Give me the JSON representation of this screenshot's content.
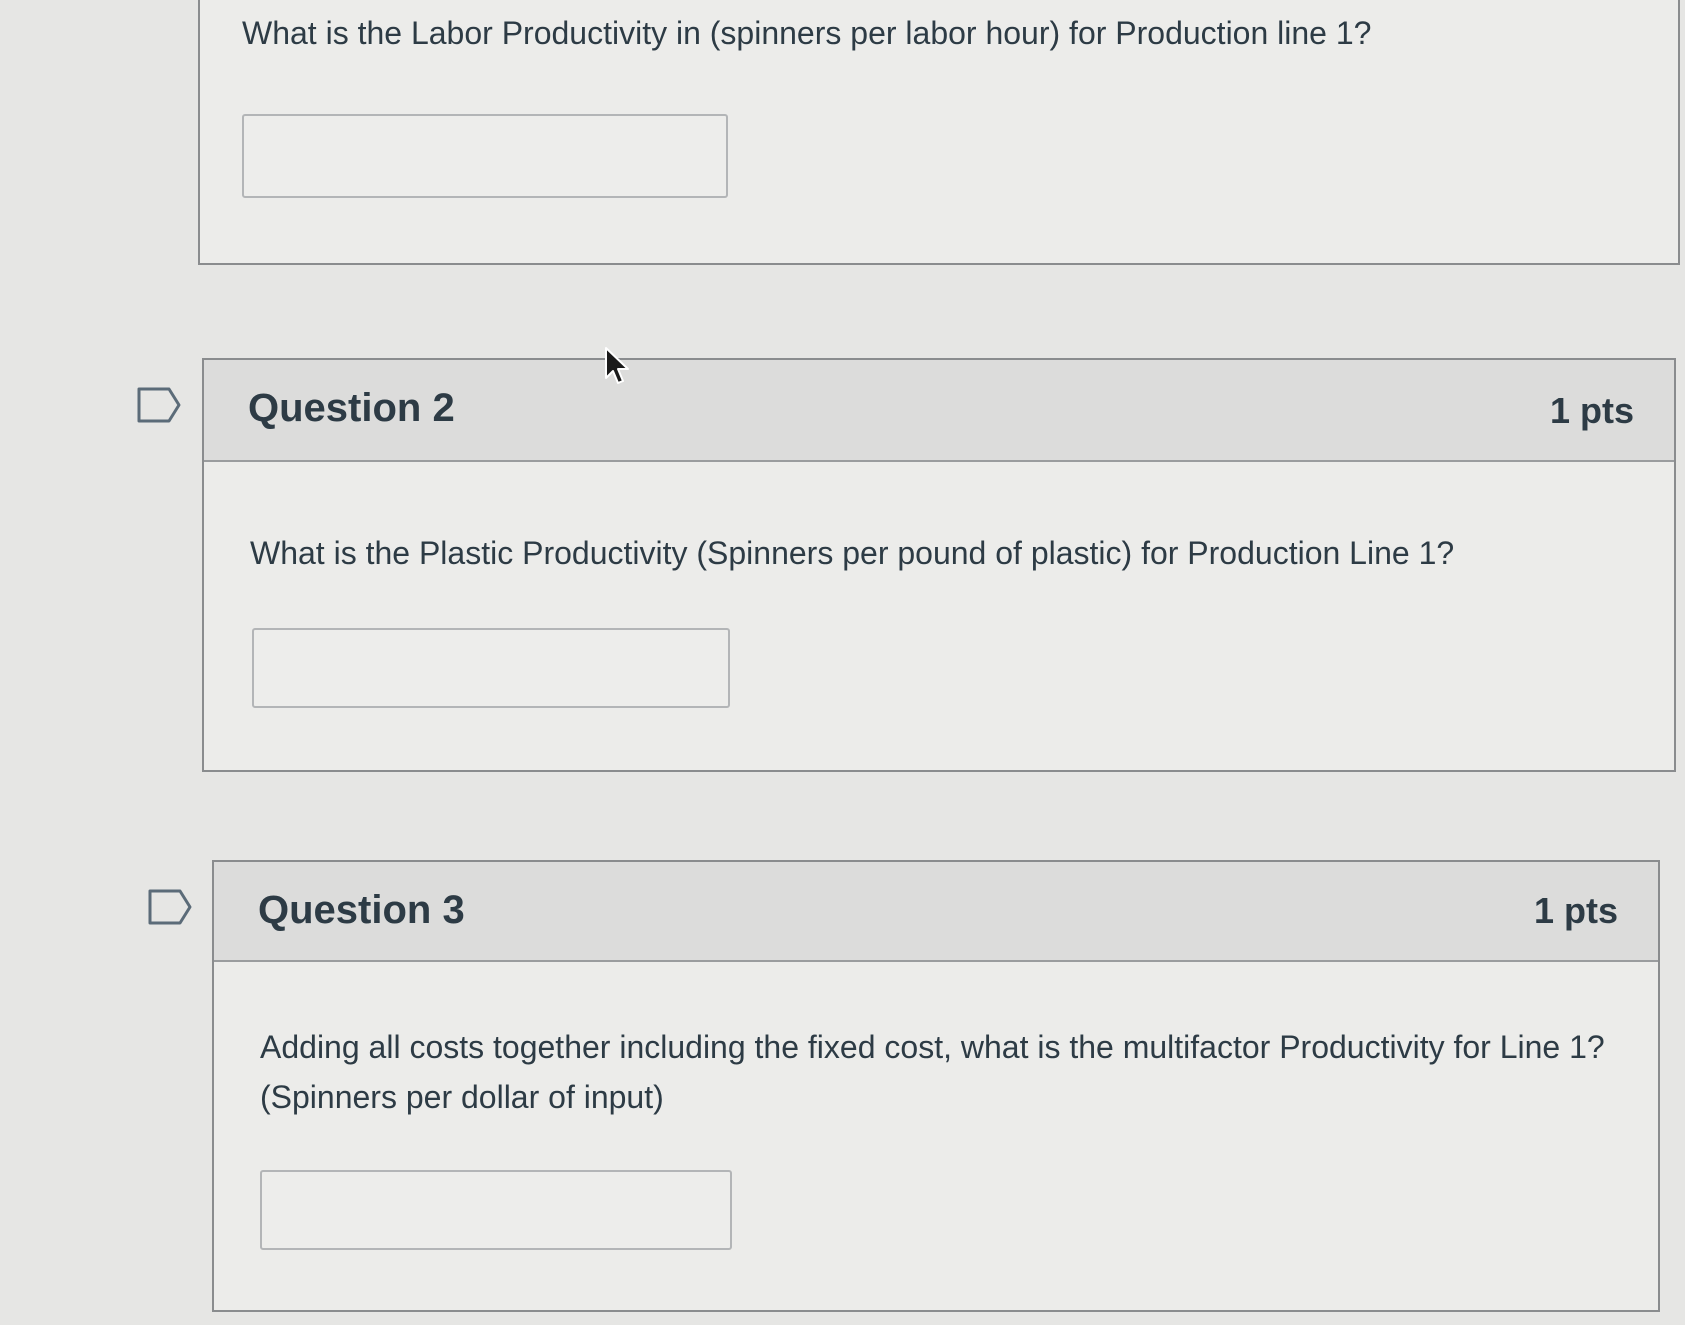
{
  "question1": {
    "text": "What is the Labor Productivity in (spinners per labor hour) for Production line 1?",
    "answer_value": ""
  },
  "question2": {
    "title": "Question 2",
    "points": "1 pts",
    "text": "What is the Plastic Productivity (Spinners per pound of plastic) for Production Line 1?",
    "answer_value": ""
  },
  "question3": {
    "title": "Question 3",
    "points": "1 pts",
    "text": "Adding all costs together including the fixed cost, what is the multifactor Productivity for Line 1? (Spinners per dollar of input)",
    "answer_value": ""
  },
  "icons": {
    "flag": "flag-question-icon",
    "cursor": "mouse-pointer-icon"
  }
}
